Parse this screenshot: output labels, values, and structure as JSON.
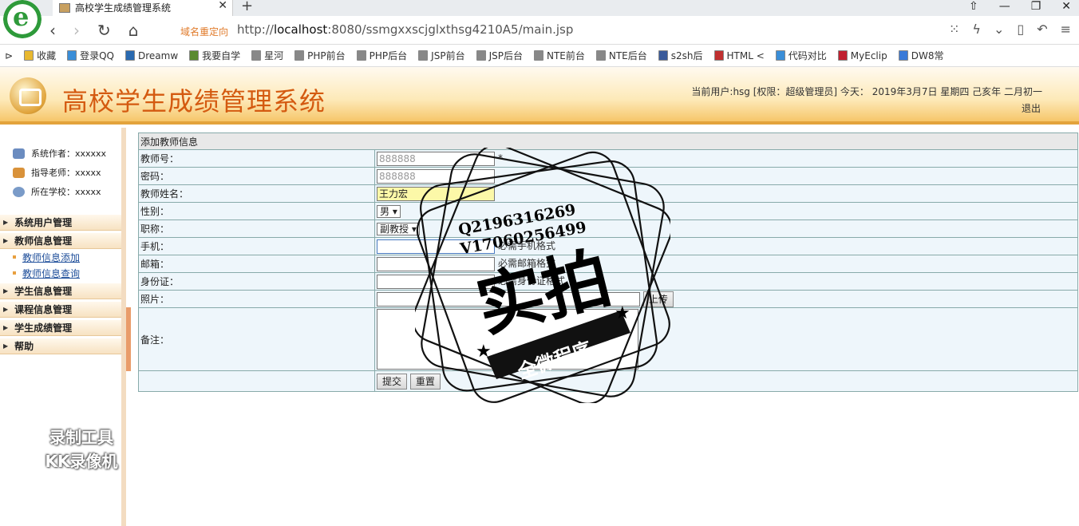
{
  "browser": {
    "tab_title": "高校学生成绩管理系统",
    "redirect_label": "域名重定向",
    "url_prefix": "http://",
    "url_host": "localhost",
    "url_rest": ":8080/ssmgxxscjglxthsg4210A5/main.jsp",
    "bookmarks": [
      "收藏",
      "登录QQ",
      "Dreamw",
      "我要自学",
      "星河",
      "PHP前台",
      "PHP后台",
      "JSP前台",
      "JSP后台",
      "NTE前台",
      "NTE后台",
      "s2sh后",
      "HTML <",
      "代码对比",
      "MyEclip",
      "DW8常"
    ]
  },
  "header": {
    "title": "高校学生成绩管理系统",
    "user_info": "当前用户:hsg [权限：超级管理员] 今天： 2019年3月7日 星期四 己亥年 二月初一",
    "logout": "退出"
  },
  "sidebar": {
    "info": [
      "系统作者：xxxxxx",
      "指导老师：xxxxx",
      "所在学校：xxxxx"
    ],
    "menus": [
      {
        "label": "系统用户管理"
      },
      {
        "label": "教师信息管理",
        "children": [
          "教师信息添加",
          "教师信息查询"
        ]
      },
      {
        "label": "学生信息管理"
      },
      {
        "label": "课程信息管理"
      },
      {
        "label": "学生成绩管理"
      },
      {
        "label": "帮助"
      }
    ]
  },
  "form": {
    "caption": "添加教师信息",
    "teacher_no_label": "教师号：",
    "teacher_no_value": "888888",
    "required_mark": "*",
    "password_label": "密码：",
    "password_value": "888888",
    "name_label": "教师姓名：",
    "name_value": "王力宏",
    "gender_label": "性别：",
    "gender_value": "男",
    "title_label": "职称：",
    "title_value": "副教授",
    "phone_label": "手机：",
    "phone_hint": "必需手机格式",
    "email_label": "邮箱：",
    "email_hint": "必需邮箱格式",
    "idcard_label": "身份证：",
    "idcard_hint": "必需身份证格式",
    "photo_label": "照片：",
    "upload_label": "上传",
    "remark_label": "备注：",
    "submit_label": "提交",
    "reset_label": "重置"
  },
  "watermark": {
    "line1": "Q2196316269",
    "line2": "V17060256499",
    "big": "实拍",
    "banner": "全微程序"
  },
  "recorder": {
    "line1": "录制工具",
    "line2": "KK录像机"
  }
}
